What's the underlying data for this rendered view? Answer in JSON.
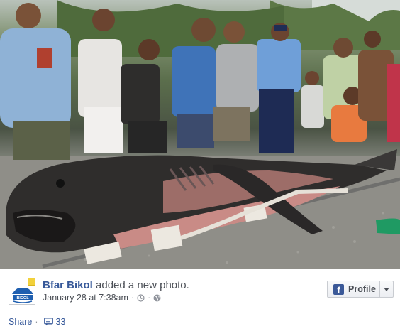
{
  "post": {
    "page_name": "Bfar Bikol",
    "action": "added a new photo.",
    "timestamp": "January 28 at 7:38am",
    "meta_separator": "·",
    "avatar_text": "BICOL",
    "profile_button_label": "Profile",
    "share_label": "Share",
    "comment_count": "33"
  },
  "icons": {
    "clock": "clock-icon",
    "globe": "globe-icon",
    "comment": "comment-icon",
    "facebook": "facebook-logo-icon",
    "caret": "chevron-down-icon"
  },
  "colors": {
    "link_blue": "#365899",
    "facebook_blue": "#3b5998",
    "meta_gray": "#4b4f56"
  }
}
